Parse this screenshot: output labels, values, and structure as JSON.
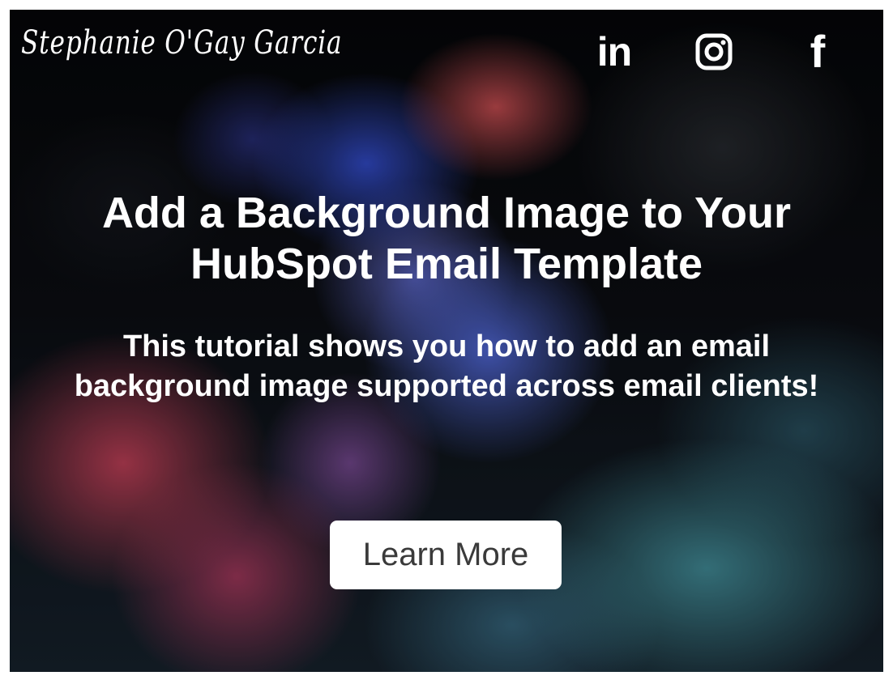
{
  "header": {
    "signature": "Stephanie O'Gay Garcia",
    "social": [
      {
        "icon": "linkedin-icon",
        "glyph": "in"
      },
      {
        "icon": "instagram-icon"
      },
      {
        "icon": "facebook-icon",
        "glyph": "f"
      }
    ]
  },
  "hero": {
    "headline": "Add a Background Image to Your HubSpot Email Template",
    "subhead": "This tutorial shows you how to add an email background image supported across email clients!",
    "cta_label": "Learn More"
  },
  "colors": {
    "text": "#ffffff",
    "button_bg": "#ffffff",
    "button_text": "#3a3a3a"
  }
}
